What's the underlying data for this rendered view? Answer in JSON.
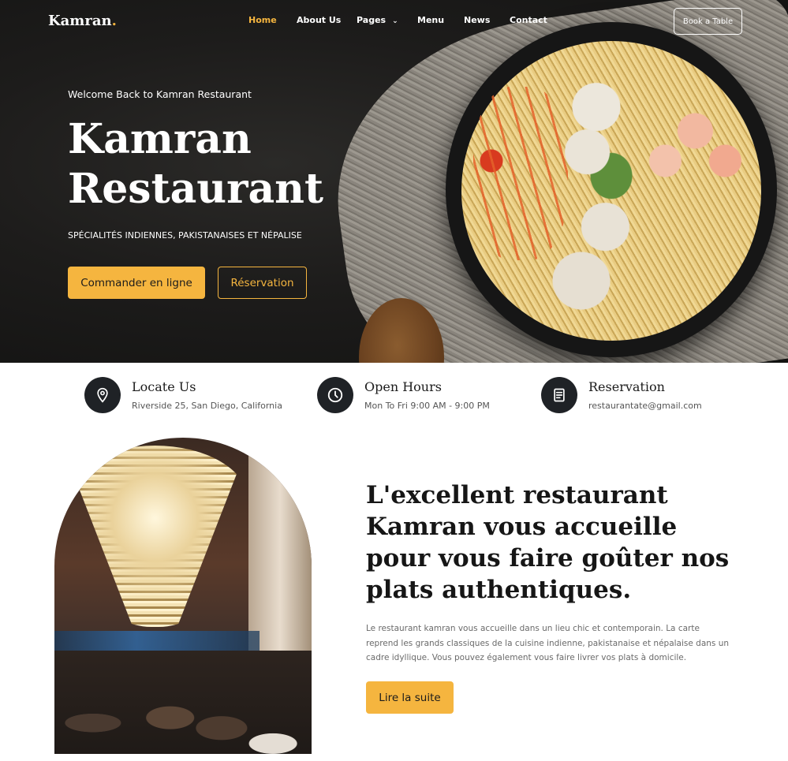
{
  "colors": {
    "accent": "#f5b53f",
    "dark": "#1f2226",
    "hero_bg": "#1a1a19"
  },
  "nav": {
    "logo": "Kamran",
    "logo_dot": ".",
    "items": [
      {
        "label": "Home",
        "active": true
      },
      {
        "label": "About Us"
      },
      {
        "label": "Pages",
        "has_dropdown": true
      },
      {
        "label": "Menu"
      },
      {
        "label": "News"
      },
      {
        "label": "Contact"
      }
    ],
    "cta": "Book a Table"
  },
  "hero": {
    "welcome": "Welcome Back to Kamran Restaurant",
    "title_line1": "Kamran",
    "title_line2": "Restaurant",
    "subtitle": "SPÉCIALITÉS INDIENNES, PAKISTANAISES ET NÉPALISE",
    "primary_button": "Commander en ligne",
    "secondary_button": "Réservation"
  },
  "info": [
    {
      "icon": "location-pin-icon",
      "title": "Locate Us",
      "text": "Riverside 25, San Diego, California"
    },
    {
      "icon": "clock-icon",
      "title": "Open Hours",
      "text": "Mon To Fri 9:00 AM - 9:00 PM"
    },
    {
      "icon": "reservation-receipt-icon",
      "title": "Reservation",
      "text": "restaurantate@gmail.com"
    }
  ],
  "about": {
    "heading": "L'excellent restaurant Kamran vous accueille pour vous faire goûter nos plats authentiques.",
    "body": "Le restaurant kamran vous accueille dans un lieu chic et contemporain. La carte reprend les grands classiques de la cuisine indienne, pakistanaise et népalaise dans un cadre idyllique. Vous pouvez également vous faire livrer vos plats à domicile.",
    "button": "Lire la suite"
  }
}
